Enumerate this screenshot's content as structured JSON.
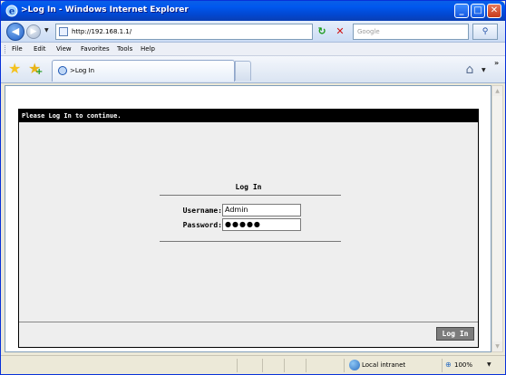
{
  "window": {
    "title": ">Log In - Windows Internet Explorer"
  },
  "address_bar": {
    "url": "http://192.168.1.1/"
  },
  "search": {
    "placeholder": "Google"
  },
  "menu": {
    "items": [
      "File",
      "Edit",
      "View",
      "Favorites",
      "Tools",
      "Help"
    ]
  },
  "tab": {
    "label": ">Log In"
  },
  "page": {
    "header": "Please Log In to continue.",
    "login_title": "Log In",
    "username_label": "Username:",
    "username_value": "Admin",
    "password_label": "Password:",
    "password_value": "●●●●●",
    "login_button": "Log In"
  },
  "status": {
    "zone": "Local intranet",
    "zoom": "100%"
  },
  "icons": {
    "back": "back-arrow-icon",
    "forward": "forward-arrow-icon",
    "refresh": "refresh-icon",
    "stop": "stop-icon",
    "search": "search-icon",
    "favorites": "star-icon",
    "add_favorites": "add-favorite-icon",
    "home": "home-icon",
    "zone": "globe-icon",
    "zoom": "zoom-icon"
  }
}
